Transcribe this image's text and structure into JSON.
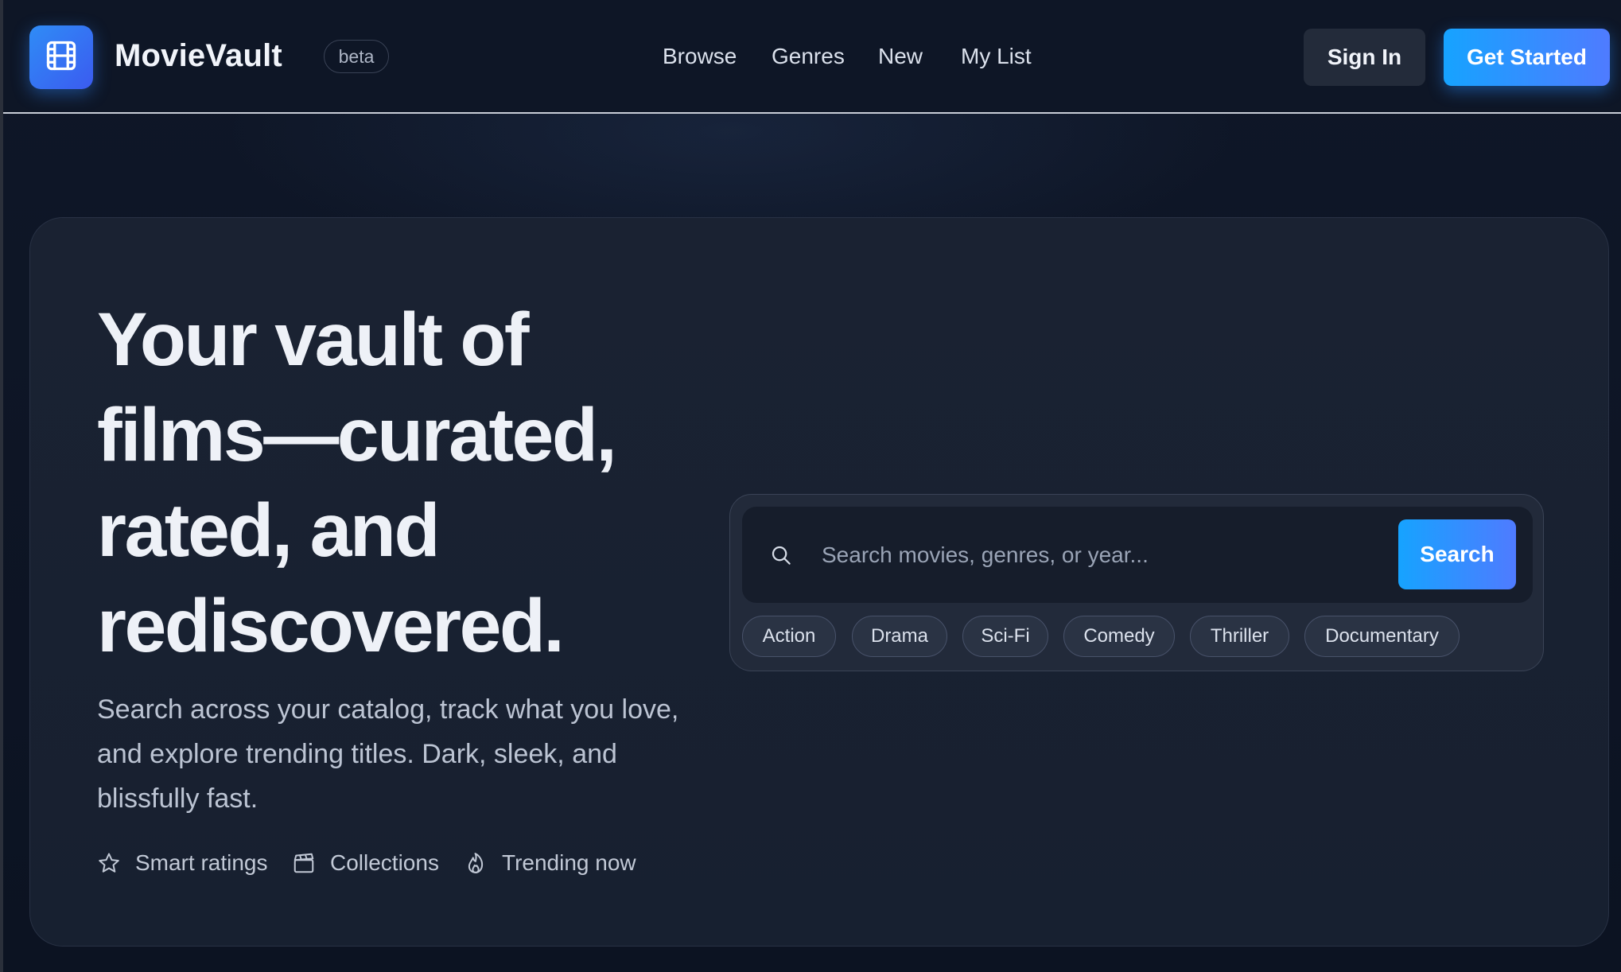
{
  "header": {
    "brand": "MovieVault",
    "badge": "beta",
    "nav": [
      "Browse",
      "Genres",
      "New",
      "My List"
    ],
    "sign_in": "Sign In",
    "get_started": "Get Started"
  },
  "hero": {
    "headline": "Your vault of films—curated, rated, and rediscovered.",
    "subtext": "Search across your catalog, track what you love, and explore trending titles. Dark, sleek, and blissfully fast.",
    "features": [
      {
        "icon": "star-icon",
        "label": "Smart ratings"
      },
      {
        "icon": "clapperboard-icon",
        "label": "Collections"
      },
      {
        "icon": "flame-icon",
        "label": "Trending now"
      }
    ]
  },
  "search": {
    "placeholder": "Search movies, genres, or year...",
    "button": "Search",
    "genres": [
      "Action",
      "Drama",
      "Sci-Fi",
      "Comedy",
      "Thriller",
      "Documentary"
    ]
  },
  "colors": {
    "accent_start": "#16a3ff",
    "accent_end": "#4f7bff",
    "background": "#0d1424",
    "card": "#1a2232"
  }
}
